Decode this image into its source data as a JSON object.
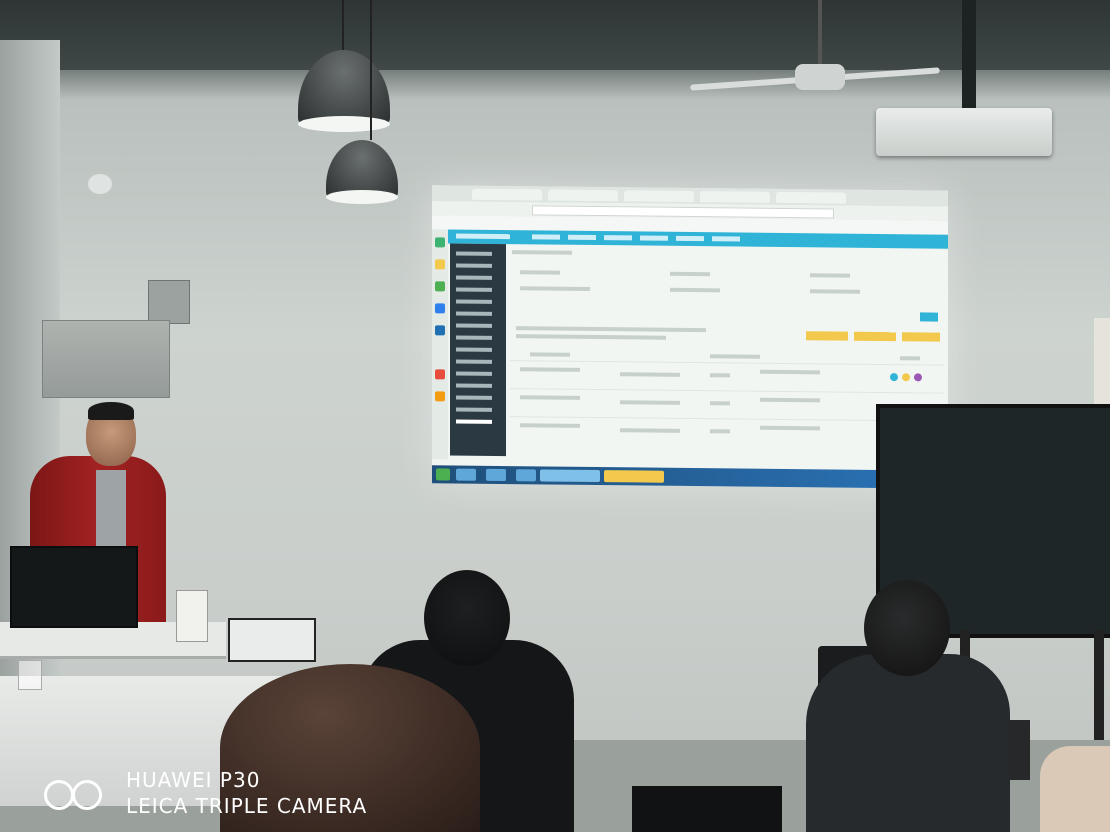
{
  "photo": {
    "scene": "classroom-projection",
    "watermark": {
      "line1": "HUAWEI P30",
      "line2": "LEICA TRIPLE CAMERA",
      "text_color": "#ffffff"
    },
    "colors": {
      "projector_nav": "#2fb3d6",
      "presenter_jacket": "#a32222",
      "screen_button": "#f2c94c",
      "taskbar": "#2b74b8"
    }
  }
}
